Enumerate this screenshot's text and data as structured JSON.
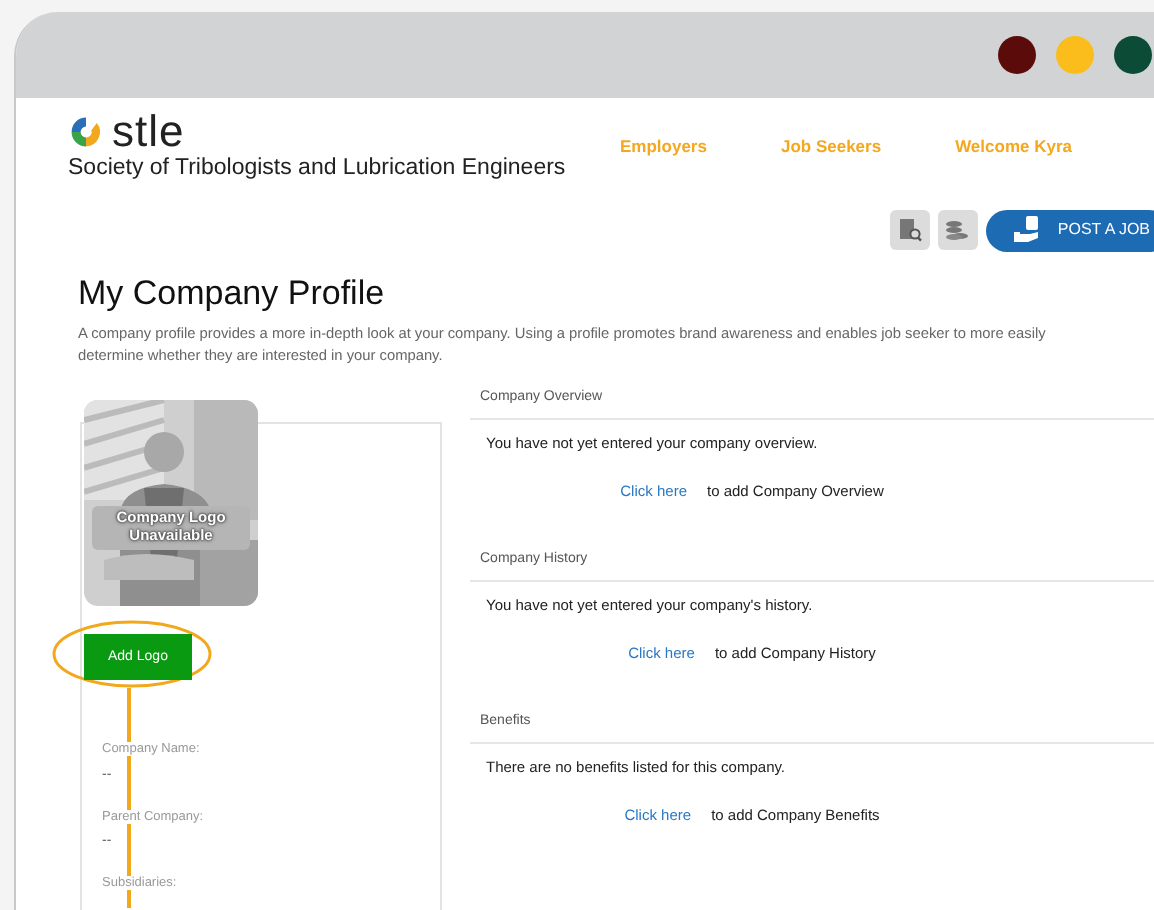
{
  "window": {
    "controls": [
      {
        "color": "#5c0b0b"
      },
      {
        "color": "#fbbd1c"
      },
      {
        "color": "#0c4c36"
      }
    ]
  },
  "header": {
    "logo_text": "stle",
    "org_name": "Society of Tribologists and Lubrication Engineers",
    "nav": [
      "Employers",
      "Job Seekers",
      "Welcome Kyra"
    ]
  },
  "toolbar": {
    "post_button": "POST A JOB"
  },
  "page": {
    "title": "My Company Profile",
    "description": "A company profile provides a more in-depth look at your company. Using a profile promotes brand awareness and enables job seeker to more easily determine whether they are interested in your company."
  },
  "logo_panel": {
    "caption": [
      "Company Logo",
      "Unavailable"
    ],
    "add_button": "Add Logo"
  },
  "fields": [
    {
      "label": "Company Name:",
      "value": "--"
    },
    {
      "label": "Parent Company:",
      "value": "--"
    },
    {
      "label": "Subsidiaries:"
    }
  ],
  "sections": [
    {
      "heading": "Company Overview",
      "message": "You have not yet entered your company overview.",
      "link": "Click here",
      "link_note": "to add Company Overview"
    },
    {
      "heading": "Company History",
      "message": "You have not yet entered your company's history.",
      "link": "Click here",
      "link_note": "to add Company History"
    },
    {
      "heading": "Benefits",
      "message": "There are no benefits listed for this company.",
      "link": "Click here",
      "link_note": "to add Company Benefits"
    }
  ]
}
